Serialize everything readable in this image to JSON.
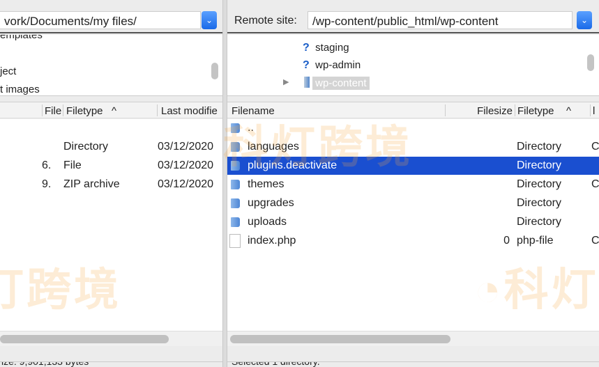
{
  "local": {
    "path": "vork/Documents/my files/",
    "tree": [
      "emplates",
      "ject",
      "t images"
    ],
    "columns": {
      "filesize": "File",
      "filetype": "Filetype",
      "sort_indicator": "^",
      "modified": "Last modifie"
    },
    "rows": [
      {
        "size": "",
        "type": "Directory",
        "modified": "03/12/2020"
      },
      {
        "size": "6.",
        "type": "File",
        "modified": "03/12/2020"
      },
      {
        "size": "9.",
        "type": "ZIP archive",
        "modified": "03/12/2020"
      }
    ],
    "status": "ize: 9,901,133 bytes"
  },
  "remote": {
    "label": "Remote site:",
    "path": "/wp-content/public_html/wp-content",
    "tree": [
      {
        "name": "staging",
        "icon": "unknown-folder-icon"
      },
      {
        "name": "wp-admin",
        "icon": "unknown-folder-icon"
      },
      {
        "name": "wp-content",
        "icon": "folder-icon",
        "selected": true
      }
    ],
    "columns": {
      "filename": "Filename",
      "filesize": "Filesize",
      "filetype": "Filetype",
      "sort_indicator": "^",
      "next": "l"
    },
    "rows": [
      {
        "name": "..",
        "size": "",
        "type": "",
        "extra": "",
        "icon": "folder-icon"
      },
      {
        "name": "languages",
        "size": "",
        "type": "Directory",
        "extra": "C",
        "icon": "folder-icon"
      },
      {
        "name": "plugins.deactivate",
        "size": "",
        "type": "Directory",
        "extra": "",
        "icon": "folder-icon",
        "selected": true
      },
      {
        "name": "themes",
        "size": "",
        "type": "Directory",
        "extra": "C",
        "icon": "folder-icon"
      },
      {
        "name": "upgrades",
        "size": "",
        "type": "Directory",
        "extra": "",
        "icon": "folder-icon"
      },
      {
        "name": "uploads",
        "size": "",
        "type": "Directory",
        "extra": "",
        "icon": "folder-icon"
      },
      {
        "name": "index.php",
        "size": "0",
        "type": "php-file",
        "extra": "C",
        "icon": "file-icon"
      }
    ],
    "status": "Selected 1 directory."
  },
  "watermark": "科灯跨境",
  "colors": {
    "selection": "#1a4fd0",
    "dropdown": "#1a6ae8",
    "watermark": "#f5aa46"
  }
}
